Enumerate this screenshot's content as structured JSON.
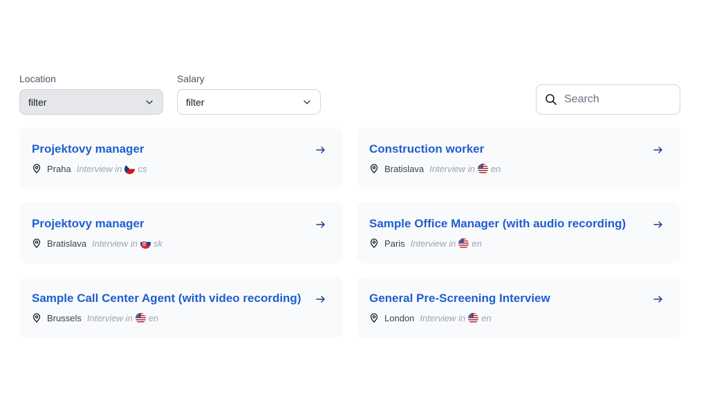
{
  "filters": {
    "location": {
      "label": "Location",
      "value": "filter"
    },
    "salary": {
      "label": "Salary",
      "value": "filter"
    }
  },
  "search": {
    "placeholder": "Search"
  },
  "interview_prefix": "Interview in",
  "jobs": [
    {
      "title": "Projektovy manager",
      "city": "Praha",
      "lang": "cs",
      "flag": "cz-flag-icon"
    },
    {
      "title": "Construction worker",
      "city": "Bratislava",
      "lang": "en",
      "flag": "us-flag-icon"
    },
    {
      "title": "Projektovy manager",
      "city": "Bratislava",
      "lang": "sk",
      "flag": "sk-flag-icon"
    },
    {
      "title": "Sample Office Manager (with audio recording)",
      "city": "Paris",
      "lang": "en",
      "flag": "us-flag-icon"
    },
    {
      "title": "Sample Call Center Agent (with video recording)",
      "city": "Brussels",
      "lang": "en",
      "flag": "us-flag-icon"
    },
    {
      "title": "General Pre-Screening Interview",
      "city": "London",
      "lang": "en",
      "flag": "us-flag-icon"
    }
  ],
  "colors": {
    "title_blue": "#1d5fd1",
    "card_bg": "#f9fafb",
    "muted": "#9ca3af"
  }
}
